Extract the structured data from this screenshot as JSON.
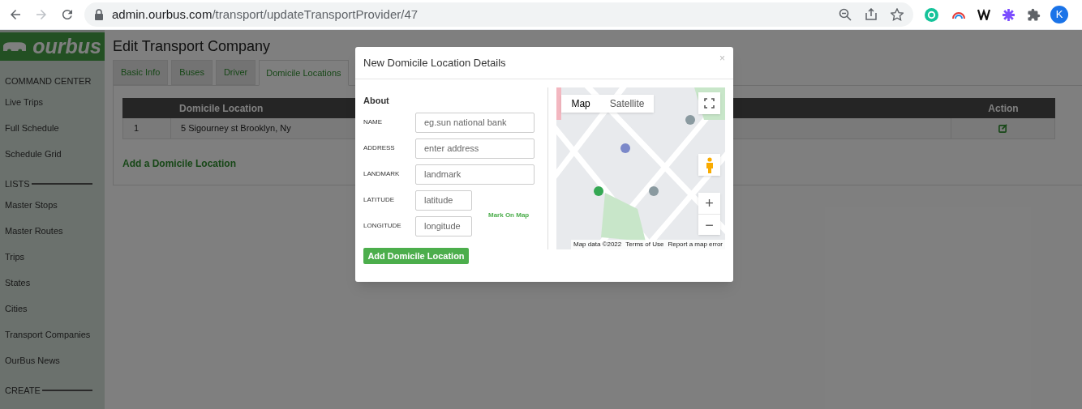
{
  "browser": {
    "url_host": "admin.ourbus.com",
    "url_path": "/transport/updateTransportProvider/47",
    "profile_initial": "K"
  },
  "sidebar": {
    "logo": "ourbus",
    "sections": [
      {
        "heading": "COMMAND CENTER",
        "items": [
          "Live Trips",
          "Full Schedule",
          "Schedule Grid"
        ]
      },
      {
        "heading": "LISTS",
        "items": [
          "Master Stops",
          "Master Routes",
          "Trips",
          "States",
          "Cities",
          "Transport Companies",
          "OurBus News"
        ]
      },
      {
        "heading": "CREATE"
      }
    ]
  },
  "page": {
    "title": "Edit Transport Company",
    "tabs": [
      {
        "label": "Basic Info",
        "selected": false
      },
      {
        "label": "Buses",
        "selected": false
      },
      {
        "label": "Driver",
        "selected": false
      },
      {
        "label": "Domicile Locations",
        "selected": true
      }
    ],
    "table": {
      "columns": [
        "",
        "Domicile Location",
        "Action"
      ],
      "rows": [
        {
          "index": "1",
          "location": "5 Sigourney st Brooklyn, Ny"
        }
      ]
    },
    "add_link": "Add a Domicile Location"
  },
  "modal": {
    "title": "New Domicile Location Details",
    "close": "×",
    "section": "About",
    "fields": [
      {
        "label": "NAME",
        "placeholder": "eg.sun national bank",
        "wide": true
      },
      {
        "label": "ADDRESS",
        "placeholder": "enter address",
        "wide": true
      },
      {
        "label": "LANDMARK",
        "placeholder": "landmark",
        "wide": true
      },
      {
        "label": "LATITUDE",
        "placeholder": "latitude",
        "wide": false
      },
      {
        "label": "LONGITUDE",
        "placeholder": "longitude",
        "wide": false
      }
    ],
    "mark_link": "Mark On Map",
    "map": {
      "tabs": [
        {
          "label": "Map",
          "selected": true
        },
        {
          "label": "Satellite",
          "selected": false
        }
      ],
      "zoom_in": "+",
      "zoom_out": "−",
      "footer": [
        "Map data ©2022",
        "Terms of Use",
        "Report a map error"
      ]
    },
    "submit": "Add Domicile Location"
  }
}
